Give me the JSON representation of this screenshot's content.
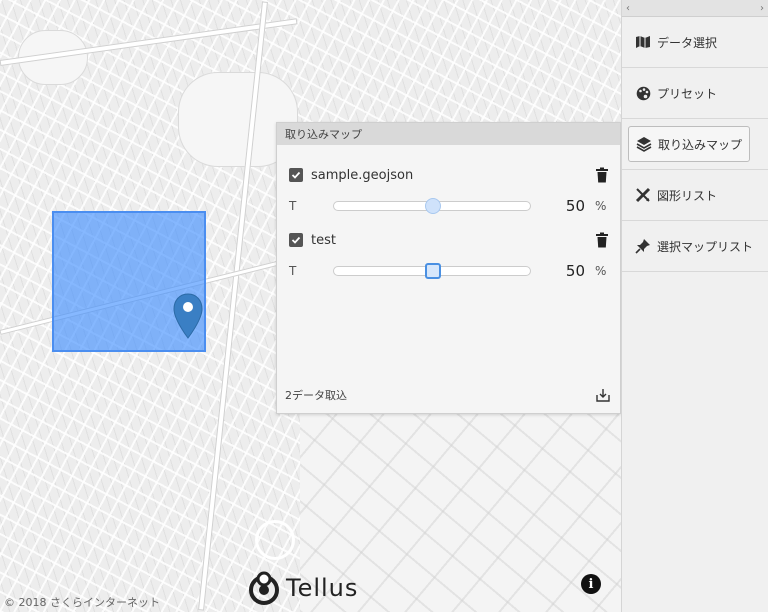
{
  "map": {
    "copyright": "© 2018 さくらインターネット",
    "logo_text": "Tellus",
    "info_label": "i"
  },
  "sidebar": {
    "collapse_left": "‹",
    "collapse_right": "›",
    "items": [
      {
        "label": "データ選択",
        "icon": "map-icon"
      },
      {
        "label": "プリセット",
        "icon": "palette-icon"
      },
      {
        "label": "取り込みマップ",
        "icon": "layers-icon"
      },
      {
        "label": "図形リスト",
        "icon": "ruler-pencil-icon"
      },
      {
        "label": "選択マップリスト",
        "icon": "pin-icon"
      }
    ]
  },
  "panel": {
    "title": "取り込みマップ",
    "layers": [
      {
        "name": "sample.geojson",
        "checked": true,
        "t_label": "T",
        "value": "50",
        "unit": "%",
        "opacity": 0.5
      },
      {
        "name": "test",
        "checked": true,
        "t_label": "T",
        "value": "50",
        "unit": "%",
        "opacity": 0.5
      }
    ],
    "footer_text": "2データ取込"
  },
  "colors": {
    "geojson_fill": "#3c8cff",
    "slider_focus": "#4a90e2",
    "marker": "#3a7fc4"
  }
}
